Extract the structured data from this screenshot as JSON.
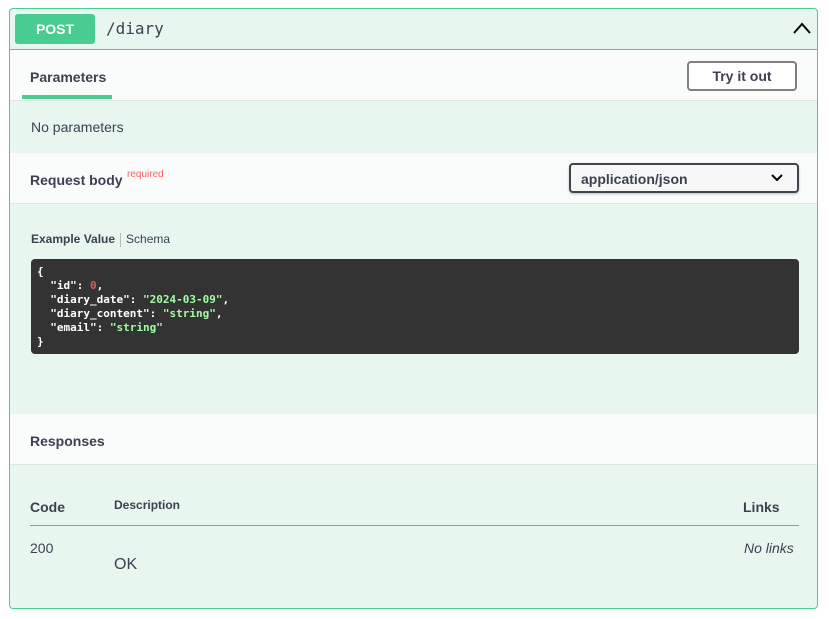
{
  "operation": {
    "method": "POST",
    "path": "/diary"
  },
  "parameters": {
    "tab_label": "Parameters",
    "try_button": "Try it out",
    "empty_text": "No parameters"
  },
  "request_body": {
    "title": "Request body",
    "required_label": "required",
    "content_type": "application/json",
    "example_tab": "Example Value",
    "schema_tab": "Schema",
    "example": [
      {
        "key": "\"id\"",
        "value": "0",
        "type": "number"
      },
      {
        "key": "\"diary_date\"",
        "value": "\"2024-03-09\"",
        "type": "string"
      },
      {
        "key": "\"diary_content\"",
        "value": "\"string\"",
        "type": "string"
      },
      {
        "key": "\"email\"",
        "value": "\"string\"",
        "type": "string"
      }
    ]
  },
  "responses": {
    "title": "Responses",
    "columns": {
      "code": "Code",
      "description": "Description",
      "links": "Links"
    },
    "rows": [
      {
        "code": "200",
        "description": "OK",
        "links": "No links"
      }
    ]
  },
  "colors": {
    "post_accent": "#49cc90",
    "block_bg": "#e8f6f0",
    "code_bg": "#333333"
  }
}
